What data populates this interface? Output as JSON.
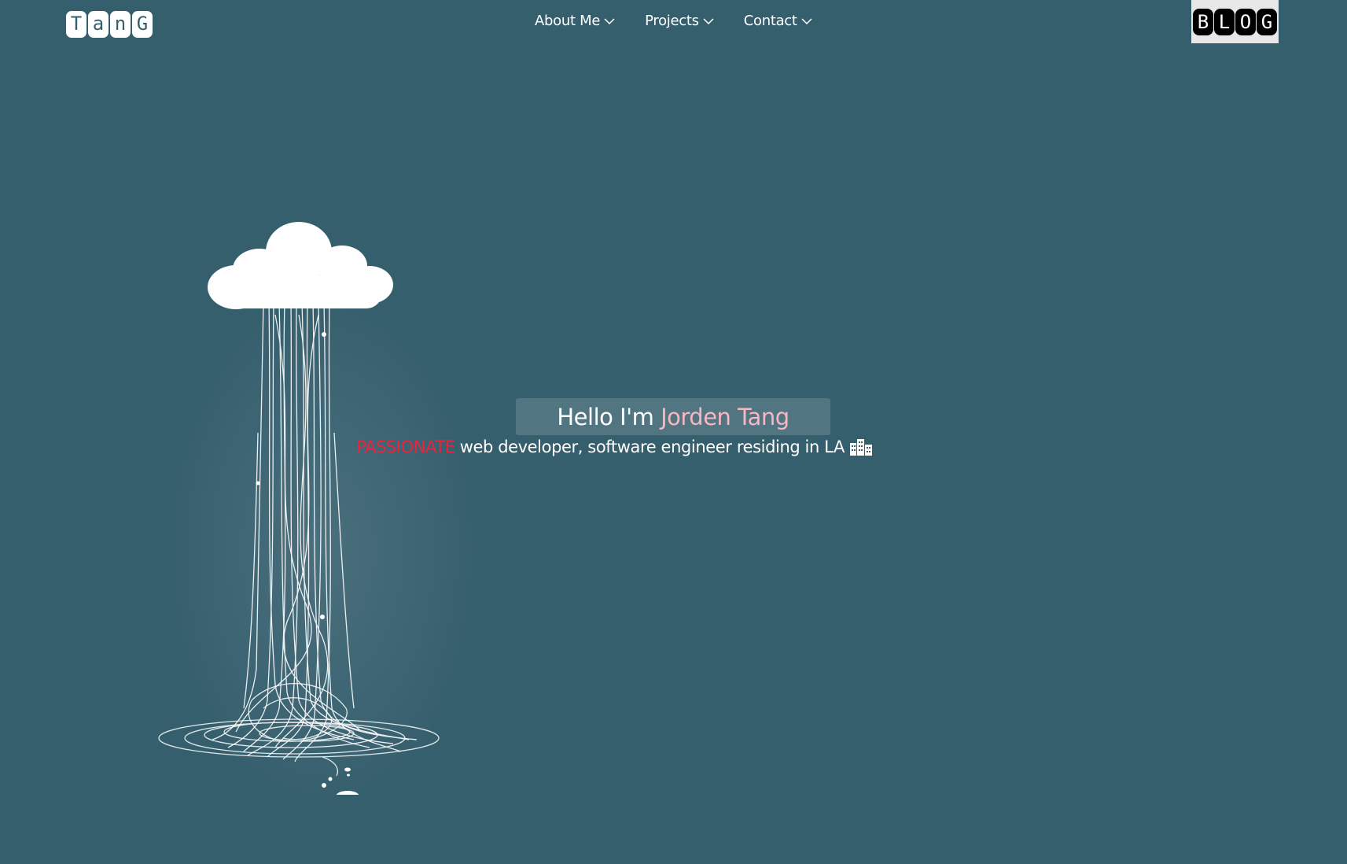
{
  "header": {
    "logo_letters": [
      "T",
      "a",
      "n",
      "G"
    ],
    "nav": [
      {
        "label": "About Me",
        "icon": "chevron-down-icon"
      },
      {
        "label": "Projects",
        "icon": "chevron-down-icon"
      },
      {
        "label": "Contact",
        "icon": "chevron-down-icon"
      }
    ],
    "blog_letters": [
      "B",
      "L",
      "O",
      "G"
    ]
  },
  "hero": {
    "greeting": "Hello I'm",
    "name": "Jorden Tang",
    "highlight_word": "PASSIONATE",
    "tagline": "web developer, software engineer residing in LA",
    "tagline_icon": "city-buildings-icon"
  },
  "colors": {
    "background": "#365f6e",
    "name_accent": "#f7b6c2",
    "highlight": "#e8243f"
  }
}
